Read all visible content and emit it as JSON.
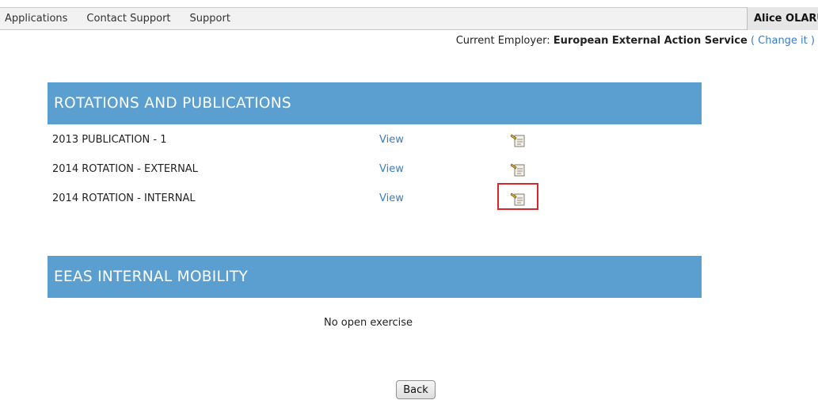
{
  "topbar": {
    "nav": [
      "Applications",
      "Contact Support",
      "Support"
    ],
    "user_name": "Alice OLARU"
  },
  "employer": {
    "label": "Current Employer:",
    "name": "European External Action Service",
    "open_paren": "(",
    "change_link": "Change it",
    "close_paren": ")"
  },
  "rotations": {
    "title": "ROTATIONS AND PUBLICATIONS",
    "rows": [
      {
        "name": "2013 PUBLICATION - 1",
        "view": "View",
        "icon": "document-edit-icon"
      },
      {
        "name": "2014 ROTATION - EXTERNAL",
        "view": "View",
        "icon": "document-edit-icon"
      },
      {
        "name": "2014 ROTATION - INTERNAL",
        "view": "View",
        "icon": "document-edit-icon"
      }
    ]
  },
  "mobility": {
    "title": "EEAS INTERNAL MOBILITY",
    "empty_message": "No open exercise"
  },
  "actions": {
    "back_label": "Back"
  },
  "colors": {
    "section_header": "#5a9fd0",
    "link": "#3a7ec2",
    "highlight": "#d8262b"
  }
}
